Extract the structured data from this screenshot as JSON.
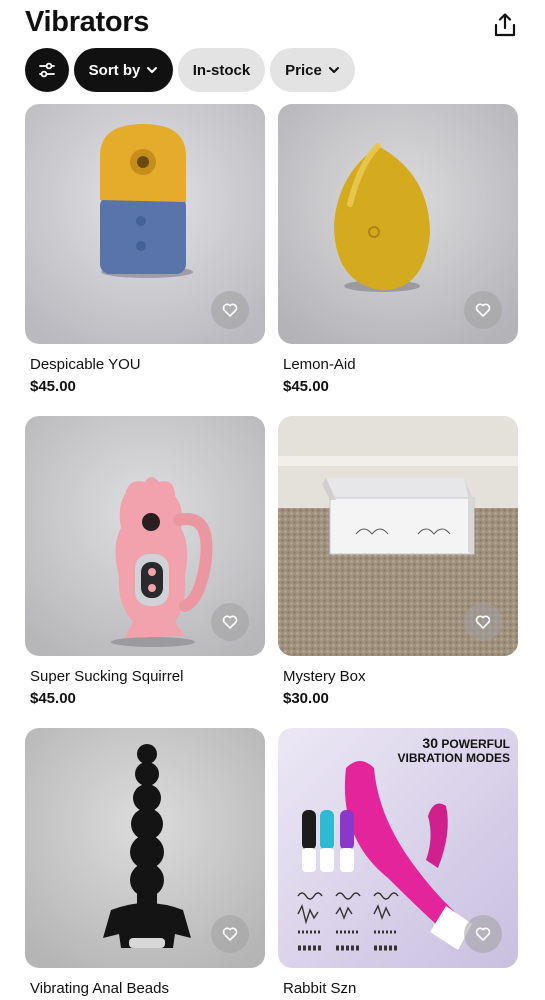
{
  "header": {
    "title": "Vibrators",
    "share_icon": "share-icon"
  },
  "filters": {
    "filter_icon": "sliders-icon",
    "sort_label": "Sort by",
    "instock_label": "In-stock",
    "price_label": "Price"
  },
  "products": [
    {
      "name": "Despicable YOU",
      "price": "$45.00",
      "favorite": false
    },
    {
      "name": "Lemon-Aid",
      "price": "$45.00",
      "favorite": false
    },
    {
      "name": "Super Sucking Squirrel",
      "price": "$45.00",
      "favorite": false
    },
    {
      "name": "Mystery Box",
      "price": "$30.00",
      "favorite": false
    },
    {
      "name": "Vibrating Anal Beads",
      "price": "",
      "favorite": false
    },
    {
      "name": "Rabbit Szn",
      "price": "",
      "favorite": false,
      "promo_number": "30",
      "promo_line1": "POWERFUL",
      "promo_line2": "VIBRATION MODES"
    }
  ]
}
